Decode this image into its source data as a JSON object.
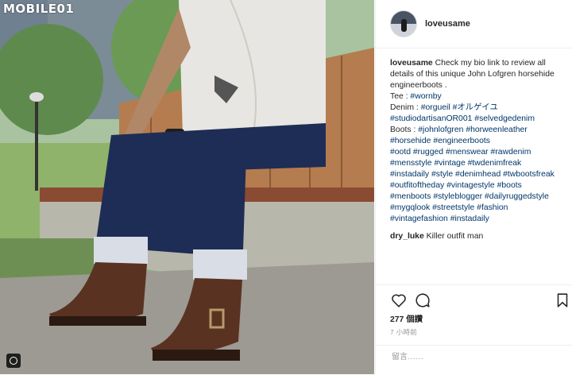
{
  "watermark": "MOBILE01",
  "post": {
    "author": "loveusame",
    "caption": [
      {
        "t": "text",
        "v": "Check my bio link to review all details of this unique John Lofgren horsehide engineerboots ."
      },
      {
        "t": "br"
      },
      {
        "t": "text",
        "v": "Tee : "
      },
      {
        "t": "tag",
        "v": "#wornby"
      },
      {
        "t": "br"
      },
      {
        "t": "text",
        "v": "Denim : "
      },
      {
        "t": "tag",
        "v": "#orgueil"
      },
      {
        "t": "text",
        "v": " "
      },
      {
        "t": "tag",
        "v": "#オルゲイユ"
      },
      {
        "t": "text",
        "v": " "
      },
      {
        "t": "tag",
        "v": "#studiodartisanOR001"
      },
      {
        "t": "text",
        "v": " "
      },
      {
        "t": "tag",
        "v": "#selvedgedenim"
      },
      {
        "t": "br"
      },
      {
        "t": "text",
        "v": "Boots : "
      },
      {
        "t": "tag",
        "v": "#johnlofgren"
      },
      {
        "t": "text",
        "v": " "
      },
      {
        "t": "tag",
        "v": "#horweenleather"
      },
      {
        "t": "text",
        "v": " "
      },
      {
        "t": "tag",
        "v": "#horsehide"
      },
      {
        "t": "text",
        "v": " "
      },
      {
        "t": "tag",
        "v": "#engineerboots"
      },
      {
        "t": "br"
      },
      {
        "t": "tag",
        "v": "#ootd"
      },
      {
        "t": "text",
        "v": " "
      },
      {
        "t": "tag",
        "v": "#rugged"
      },
      {
        "t": "text",
        "v": " "
      },
      {
        "t": "tag",
        "v": "#menswear"
      },
      {
        "t": "text",
        "v": " "
      },
      {
        "t": "tag",
        "v": "#rawdenim"
      },
      {
        "t": "text",
        "v": " "
      },
      {
        "t": "tag",
        "v": "#mensstyle"
      },
      {
        "t": "text",
        "v": " "
      },
      {
        "t": "tag",
        "v": "#vintage"
      },
      {
        "t": "text",
        "v": " "
      },
      {
        "t": "tag",
        "v": "#twdenimfreak"
      },
      {
        "t": "text",
        "v": " "
      },
      {
        "t": "tag",
        "v": "#instadaily"
      },
      {
        "t": "text",
        "v": " "
      },
      {
        "t": "tag",
        "v": "#style"
      },
      {
        "t": "text",
        "v": " "
      },
      {
        "t": "tag",
        "v": "#denimhead"
      },
      {
        "t": "text",
        "v": " "
      },
      {
        "t": "tag",
        "v": "#twbootsfreak"
      },
      {
        "t": "text",
        "v": " "
      },
      {
        "t": "tag",
        "v": "#outfitoftheday"
      },
      {
        "t": "text",
        "v": " "
      },
      {
        "t": "tag",
        "v": "#vintagestyle"
      },
      {
        "t": "text",
        "v": " "
      },
      {
        "t": "tag",
        "v": "#boots"
      },
      {
        "t": "text",
        "v": " "
      },
      {
        "t": "tag",
        "v": "#menboots"
      },
      {
        "t": "text",
        "v": " "
      },
      {
        "t": "tag",
        "v": "#styleblogger"
      },
      {
        "t": "text",
        "v": " "
      },
      {
        "t": "tag",
        "v": "#dailyruggedstyle"
      },
      {
        "t": "text",
        "v": " "
      },
      {
        "t": "tag",
        "v": "#mygqlook"
      },
      {
        "t": "text",
        "v": " "
      },
      {
        "t": "tag",
        "v": "#streetstyle"
      },
      {
        "t": "text",
        "v": " "
      },
      {
        "t": "tag",
        "v": "#fashion"
      },
      {
        "t": "text",
        "v": " "
      },
      {
        "t": "tag",
        "v": "#vintagefashion"
      },
      {
        "t": "text",
        "v": " "
      },
      {
        "t": "tag",
        "v": "#instadaily"
      }
    ],
    "comment": {
      "user": "dry_luke",
      "text": "Killer outfit man"
    },
    "likes": "277 個讚",
    "time": "7 小時前",
    "comment_placeholder": "留言……"
  },
  "icons": {
    "like": "heart-icon",
    "comment": "comment-icon",
    "save": "bookmark-icon"
  },
  "colors": {
    "tag": "#003569",
    "text": "#262626",
    "muted": "#999999",
    "border": "#efefef"
  }
}
